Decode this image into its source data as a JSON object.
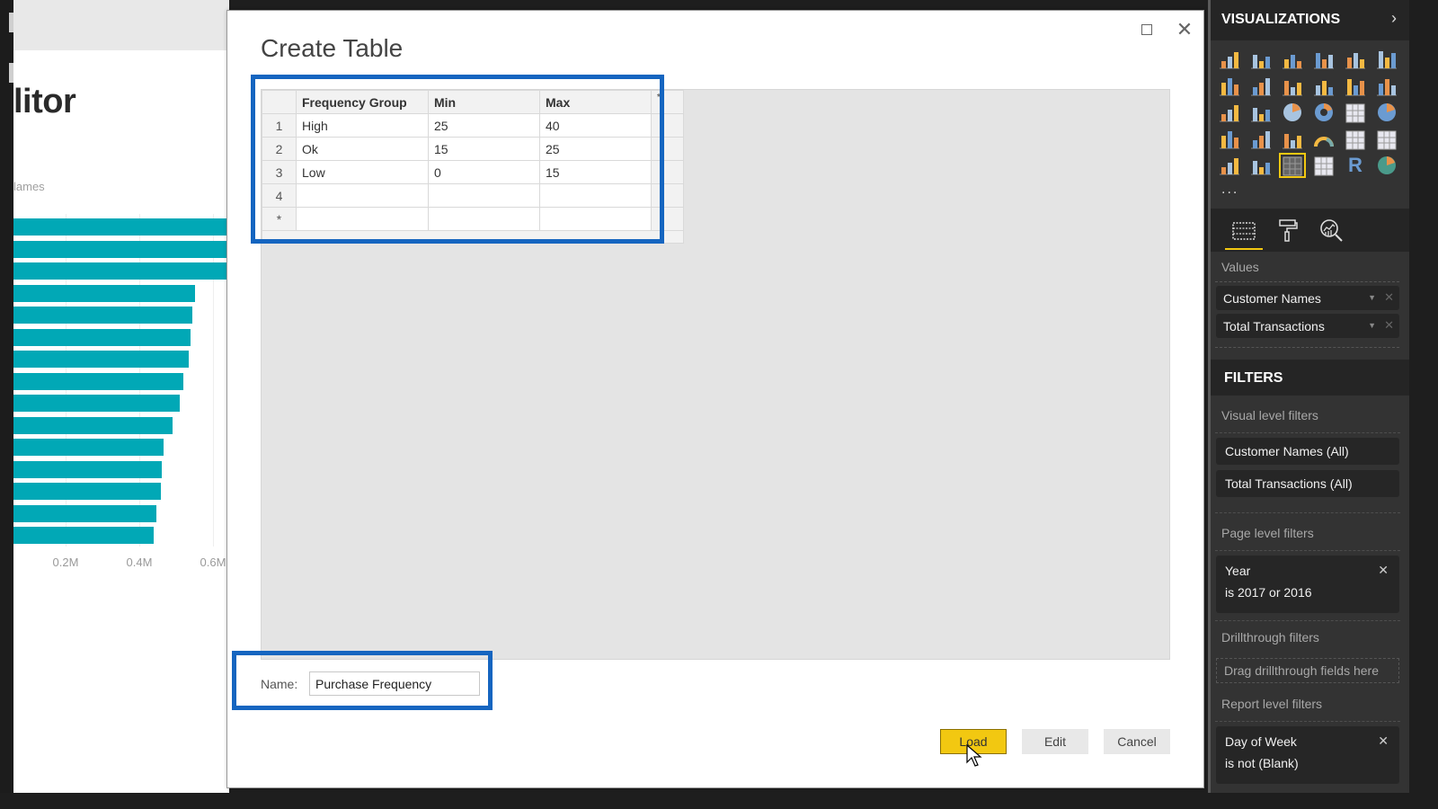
{
  "background_report": {
    "title_fragment": "litor",
    "axis_label_fragment": "lames",
    "chart_data": {
      "type": "bar",
      "orientation": "horizontal",
      "series_color": "#01a8b6",
      "values_M": [
        0.66,
        0.65,
        0.64,
        0.55,
        0.545,
        0.54,
        0.535,
        0.52,
        0.51,
        0.49,
        0.465,
        0.46,
        0.458,
        0.447,
        0.44
      ],
      "x_ticks": [
        "0.2M",
        "0.4M",
        "0.6M"
      ],
      "xlim_M": [
        0,
        0.6
      ]
    }
  },
  "dialog": {
    "title": "Create Table",
    "window_buttons": {
      "maximize": "maximize-icon",
      "close": "close-icon"
    },
    "table": {
      "columns": [
        "Frequency Group",
        "Min",
        "Max"
      ],
      "new_column_marker": "*",
      "rows": [
        {
          "num": "1",
          "cells": [
            "High",
            "25",
            "40"
          ]
        },
        {
          "num": "2",
          "cells": [
            "Ok",
            "15",
            "25"
          ]
        },
        {
          "num": "3",
          "cells": [
            "Low",
            "0",
            "15"
          ]
        },
        {
          "num": "4",
          "cells": [
            "",
            "",
            ""
          ]
        }
      ],
      "new_row_marker": "*",
      "selected_cell": {
        "row": 3,
        "column": "Max"
      }
    },
    "name_label": "Name:",
    "name_value": "Purchase Frequency",
    "buttons": {
      "load": "Load",
      "edit": "Edit",
      "cancel": "Cancel"
    },
    "highlight_color": "#1565c0",
    "load_color": "#f2c811"
  },
  "visualizations": {
    "title": "VISUALIZATIONS",
    "expand_icon": "chevron-right-icon",
    "icons": [
      "stacked-bar-chart",
      "stacked-column-chart",
      "clustered-bar-chart",
      "clustered-column-chart",
      "100-stacked-bar-chart",
      "100-stacked-column-chart",
      "line-chart",
      "area-chart",
      "stacked-area-chart",
      "line-and-stacked-column-chart",
      "line-and-clustered-column-chart",
      "ribbon-chart",
      "waterfall-chart",
      "scatter-chart",
      "pie-chart",
      "donut-chart",
      "treemap",
      "map",
      "filled-map",
      "shape-map",
      "funnel",
      "gauge",
      "card",
      "multi-row-card",
      "kpi",
      "slicer",
      "table",
      "matrix",
      "r-script-visual",
      "arcgis-map"
    ],
    "selected_icon": "table",
    "more_label": "...",
    "pane_tabs": [
      "fields-tab",
      "format-tab",
      "analytics-tab"
    ],
    "values_label": "Values",
    "value_fields": [
      "Customer Names",
      "Total Transactions"
    ]
  },
  "filters": {
    "title": "FILTERS",
    "visual_level_label": "Visual level filters",
    "visual_level": [
      "Customer Names  (All)",
      "Total Transactions  (All)"
    ],
    "page_level_label": "Page level filters",
    "page_level": [
      {
        "field": "Year",
        "condition": "is 2017 or 2016"
      }
    ],
    "drillthrough_label": "Drillthrough filters",
    "drillthrough_placeholder": "Drag drillthrough fields here",
    "report_level_label": "Report level filters",
    "report_level": [
      {
        "field": "Day of Week",
        "condition": "is not (Blank)"
      }
    ]
  }
}
